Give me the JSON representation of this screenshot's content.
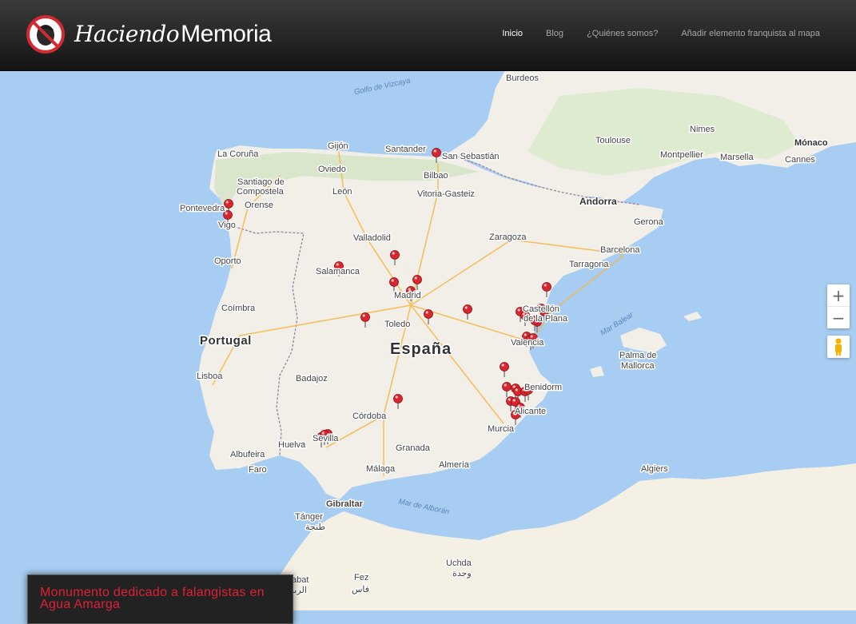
{
  "header": {
    "brand_script": "Haciendo",
    "brand_name": "Memoria",
    "nav": [
      {
        "label": "Inicio",
        "active": true
      },
      {
        "label": "Blog",
        "active": false
      },
      {
        "label": "¿Quiénes somos?",
        "active": false
      },
      {
        "label": "Añadir elemento franquista al mapa",
        "active": false
      }
    ]
  },
  "map": {
    "water_labels": {
      "biscay": "Golfo de Vizcaya",
      "balear": "Mar Balear",
      "alboran": "Mar de Alborán"
    },
    "country_labels": {
      "spain": "España",
      "portugal": "Portugal",
      "andorra": "Andorra",
      "monaco": "Mónaco"
    },
    "cities": {
      "burdeos": "Burdeos",
      "toulouse": "Toulouse",
      "nimes": "Nimes",
      "montpellier": "Montpellier",
      "marsella": "Marsella",
      "cannes": "Cannes",
      "gijon": "Gijón",
      "santander": "Santander",
      "sansebastian": "San Sebastián",
      "lacoruna": "La Coruña",
      "oviedo": "Oviedo",
      "bilbao": "Bilbao",
      "santiago1": "Santiago de",
      "santiago2": "Compostela",
      "vitoria": "Vitoria-Gasteiz",
      "leon": "León",
      "pontevedra": "Pontevedra",
      "orense": "Orense",
      "vigo": "Vigo",
      "gerona": "Gerona",
      "valladolid": "Valladolid",
      "zaragoza": "Zaragoza",
      "porto": "Oporto",
      "barcelona": "Barcelona",
      "tarragona": "Tarragona",
      "salamanca": "Salamanca",
      "madrid": "Madrid",
      "coimbra": "Coímbra",
      "castellon": "Castellón",
      "plana": "de la Plana",
      "toledo": "Toledo",
      "valencia": "Valencia",
      "palma1": "Palma de",
      "palma2": "Mallorca",
      "lisboa": "Lisboa",
      "badajoz": "Badajoz",
      "benidorm": "Benidorm",
      "alicante": "Alicante",
      "cordoba": "Córdoba",
      "murcia": "Murcia",
      "huelva": "Huelva",
      "sevilla": "Sevilla",
      "granada": "Granada",
      "albufeira": "Albufeira",
      "faro": "Faro",
      "malaga": "Málaga",
      "almeria": "Almería",
      "algiers": "Algiers",
      "gibraltar": "Gibraltar",
      "tanger": "Tánger",
      "tanger_ar": "طنجة",
      "uchda": "Uchda",
      "uchda_ar": "وجدة",
      "fez": "Fez",
      "fez_ar": "فاس",
      "rabat": "abat",
      "rabat_ar": "الربا"
    },
    "zoom_in": "+",
    "zoom_out": "−"
  },
  "info_card": {
    "title": "Monumento dedicado a falangistas en Agua Amarga"
  },
  "colors": {
    "pin": "#d8262f",
    "header_dark": "#141414",
    "card_title": "#e02035",
    "sea": "#a7cdf2",
    "land": "#f2efe9"
  }
}
